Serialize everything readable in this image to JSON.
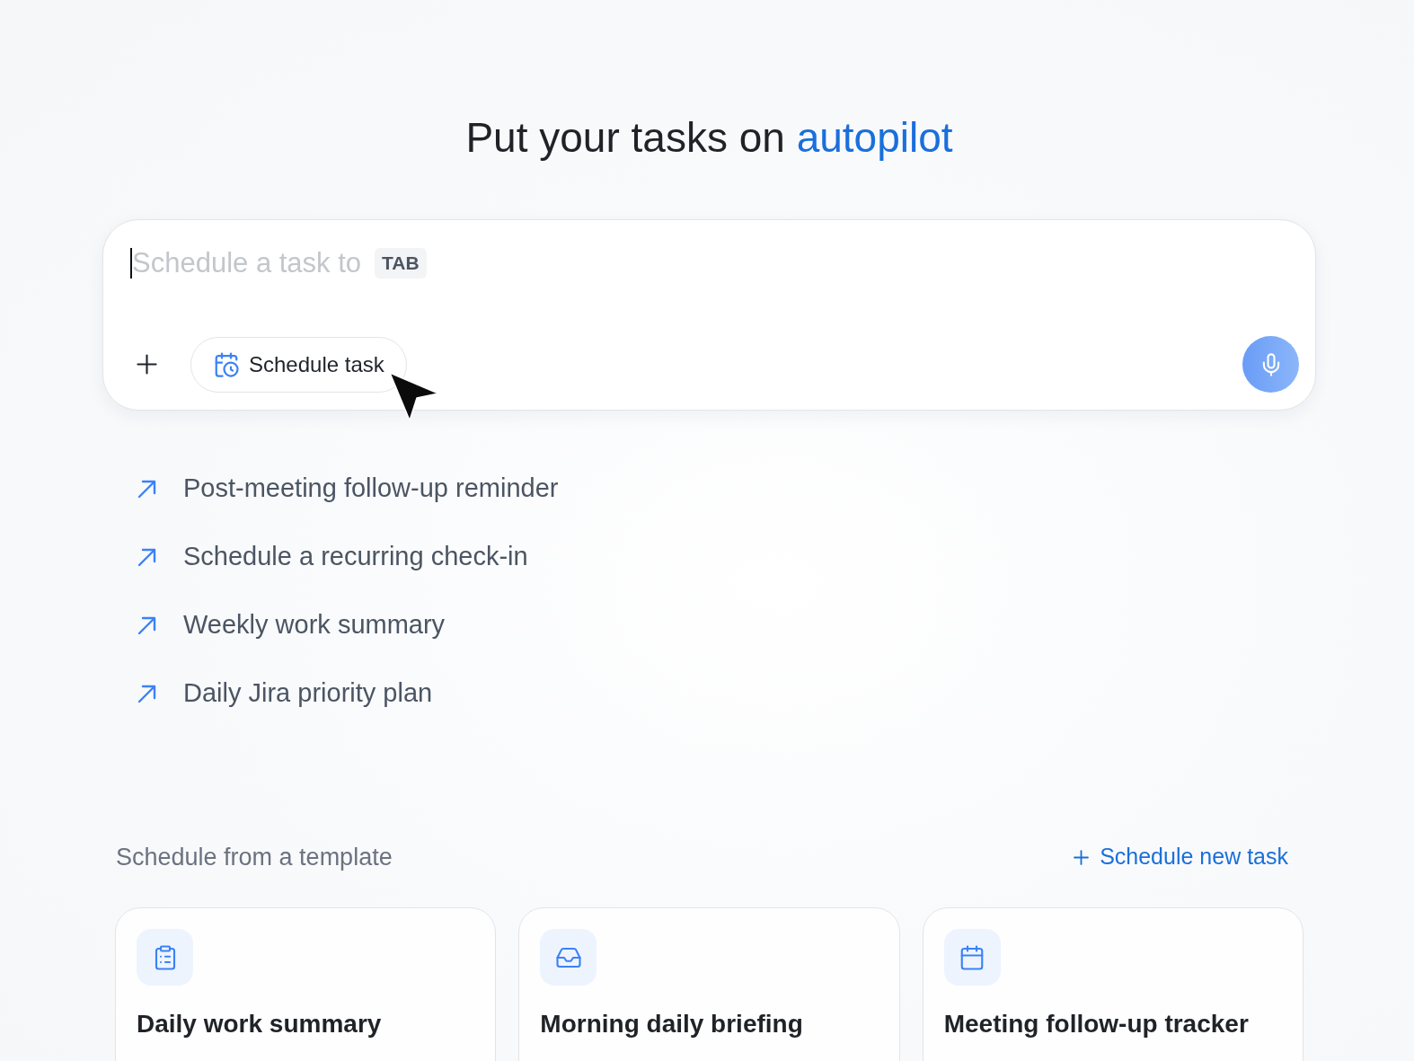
{
  "heading": "Put your tasks on **autopilot**",
  "composer": {
    "placeholder": "Schedule a task to",
    "focused": true,
    "shortcut_key": "TAB",
    "chip": "Schedule task"
  },
  "suggestions": [
    "Post-meeting follow-up reminder",
    "Schedule a recurring check-in",
    "Weekly work summary",
    "Daily Jira priority plan"
  ],
  "templates": {
    "title": "Schedule from a template",
    "action": "Schedule new task",
    "cards": [
      {
        "title": "Daily work summary"
      },
      {
        "title": "Morning daily briefing"
      },
      {
        "title": "Meeting follow-up tracker"
      }
    ]
  }
}
